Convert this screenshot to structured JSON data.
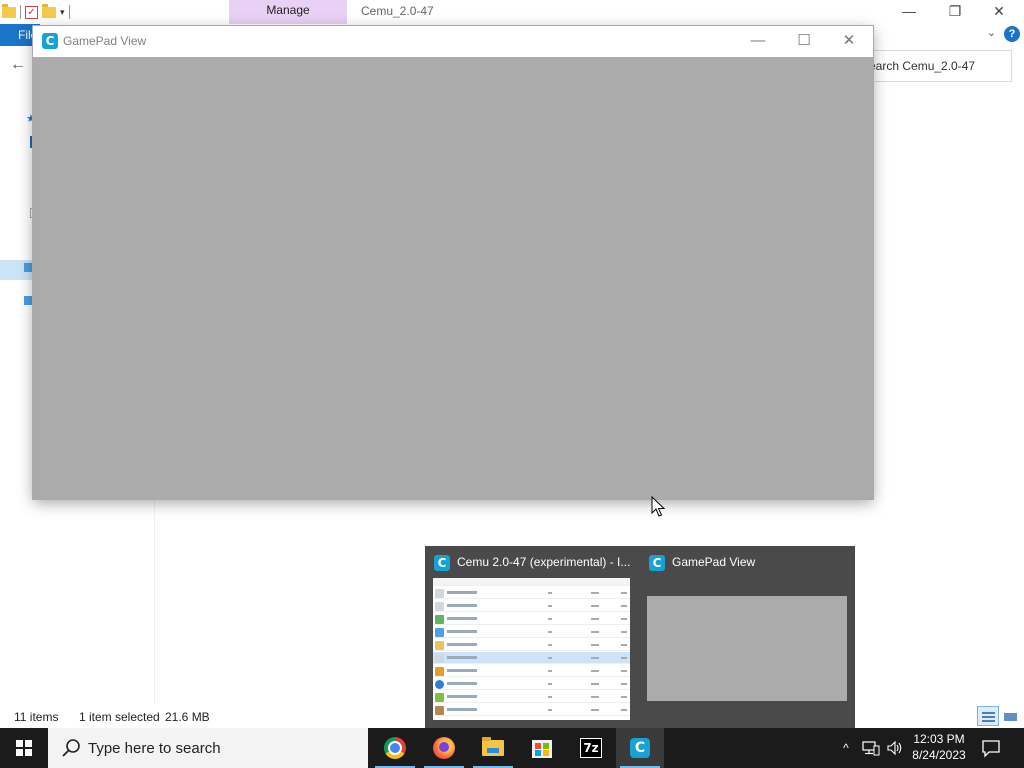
{
  "explorer": {
    "manage_tab": "Manage",
    "title": "Cemu_2.0-47",
    "file_tab": "File",
    "search_placeholder": "Search Cemu_2.0-47",
    "status": {
      "items": "11 items",
      "selected": "1 item selected",
      "size": "21.6 MB"
    }
  },
  "gamepad_window": {
    "title": "GamePad View",
    "icon": "cemu-icon",
    "content_color": "#ababab"
  },
  "thumbnails": [
    {
      "title": "Cemu 2.0-47 (experimental) - I...",
      "icon": "cemu-icon"
    },
    {
      "title": "GamePad View",
      "icon": "cemu-icon"
    }
  ],
  "taskbar": {
    "search_placeholder": "Type here to search",
    "apps": [
      "chrome-icon",
      "firefox-icon",
      "file-explorer-icon",
      "microsoft-store-icon",
      "7zip-icon",
      "cemu-icon"
    ],
    "time": "12:03 PM",
    "date": "8/24/2023"
  },
  "colors": {
    "accent": "#1a74c8",
    "manage_tab": "#e9d0f5",
    "taskbar": "#1b1b1b",
    "cemu": "#17a2d4"
  }
}
